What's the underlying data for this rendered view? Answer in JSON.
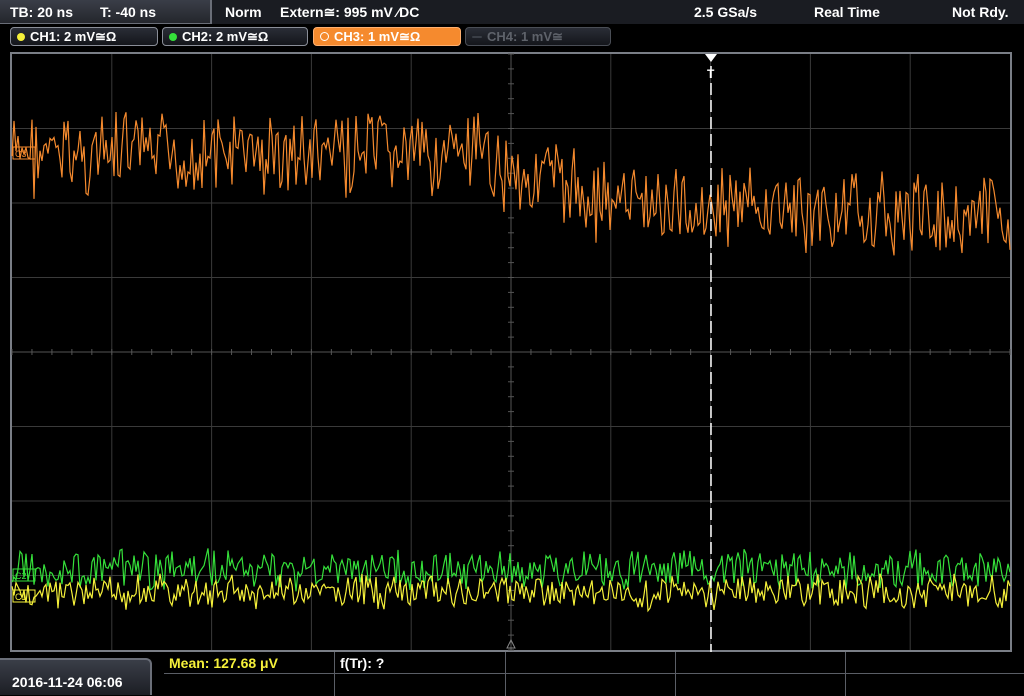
{
  "status_bar": {
    "timebase": "TB: 20 ns",
    "trigger_offset": "T: -40 ns",
    "mode": "Norm",
    "trigger": "Extern≅: 995 mV ⁄DC",
    "sample_rate": "2.5 GSa/s",
    "acquisition": "Real Time",
    "state": "Not Rdy."
  },
  "channels": [
    {
      "label": "CH1: 2 mV≅Ω",
      "color": "#f5f03a",
      "state": "on"
    },
    {
      "label": "CH2: 2 mV≅Ω",
      "color": "#35e03a",
      "state": "on"
    },
    {
      "label": "CH3: 1 mV≅Ω",
      "color": "#f58a2e",
      "state": "active"
    },
    {
      "label": "CH4: 1 mV≅",
      "color": "#5e626a",
      "state": "off"
    }
  ],
  "markers": {
    "ch3": "C3",
    "ch2": "C2",
    "ch1": "C1",
    "trigger": "T"
  },
  "measurements": {
    "mean": "Mean: 127.68 μV",
    "freq": "f(Tr): ?"
  },
  "datetime": "2016-11-24 06:06",
  "colors": {
    "grid": "#3a3a3a",
    "trigger_line": "#ffffff",
    "ch3": "#f58a2e",
    "ch2": "#35e03a",
    "ch1": "#f5f03a"
  }
}
